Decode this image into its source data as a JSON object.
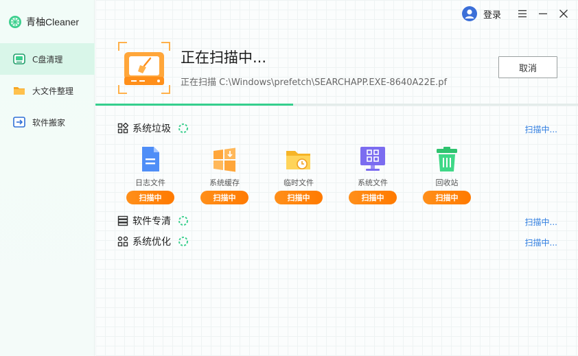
{
  "app": {
    "name": "青柚Cleaner"
  },
  "header": {
    "login_label": "登录"
  },
  "sidebar": {
    "items": [
      {
        "label": "C盘清理",
        "icon": "disk-clean-icon",
        "active": true
      },
      {
        "label": "大文件整理",
        "icon": "folder-icon",
        "active": false
      },
      {
        "label": "软件搬家",
        "icon": "move-software-icon",
        "active": false
      }
    ]
  },
  "scan": {
    "title": "正在扫描中...",
    "path": "正在扫描 C:\\Windows\\prefetch\\SEARCHAPP.EXE-8640A22E.pf",
    "cancel_label": "取消",
    "progress": 0.41
  },
  "sections": {
    "junk": {
      "title": "系统垃圾",
      "status": "扫描中..."
    },
    "software": {
      "title": "软件专清",
      "status": "扫描中..."
    },
    "optimize": {
      "title": "系统优化",
      "status": "扫描中..."
    }
  },
  "cards": [
    {
      "label": "日志文件",
      "badge": "扫描中",
      "icon": "log-file-icon"
    },
    {
      "label": "系统缓存",
      "badge": "扫描中",
      "icon": "system-cache-icon"
    },
    {
      "label": "临时文件",
      "badge": "扫描中",
      "icon": "temp-folder-icon"
    },
    {
      "label": "系统文件",
      "badge": "扫描中",
      "icon": "system-file-icon"
    },
    {
      "label": "回收站",
      "badge": "扫描中",
      "icon": "recycle-bin-icon"
    }
  ],
  "colors": {
    "accent_green": "#35cf8d",
    "badge_orange": "#ff7a00",
    "link_blue": "#2f7de0",
    "sidebar_active": "#d9f6e9"
  }
}
